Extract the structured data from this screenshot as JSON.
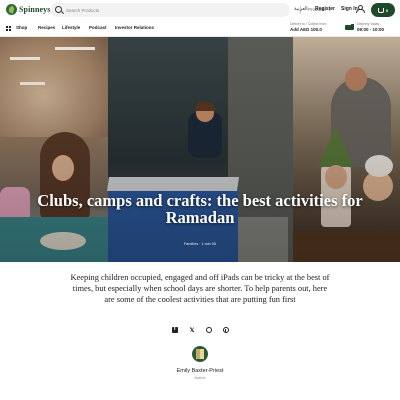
{
  "header": {
    "logo_text": "Spinneys",
    "search": {
      "placeholder": "Search Products",
      "scope": "Products"
    },
    "language": "العربية",
    "register": "Register",
    "sign_in": "Sign In",
    "cart_count": "0"
  },
  "nav": {
    "items": [
      {
        "label": "Shop"
      },
      {
        "label": "Recipes"
      },
      {
        "label": "Lifestyle"
      },
      {
        "label": "Podcast"
      },
      {
        "label": "Investor Relations"
      }
    ],
    "address_label": "Deliver to / Collect from",
    "address_value": "Add AED 100.0",
    "delivery_label": "Delivery today",
    "delivery_value": "09:00 - 10:00"
  },
  "hero": {
    "title": "Clubs, camps and crafts: the best activities for Ramadan",
    "meta": "Families · 1 min 05"
  },
  "article": {
    "intro": "Keeping children occupied, engaged and off iPads can be tricky at the best of times, but especially when school days are shorter. To help parents out, here are some of the coolest activities that are putting fun first",
    "share": {
      "x_glyph": "𝕏"
    },
    "author": {
      "name": "Emily Baxter-Priest",
      "role": "Author"
    }
  },
  "colors": {
    "brand_green": "#1f4a2a",
    "accent_green": "#8cc04f"
  }
}
